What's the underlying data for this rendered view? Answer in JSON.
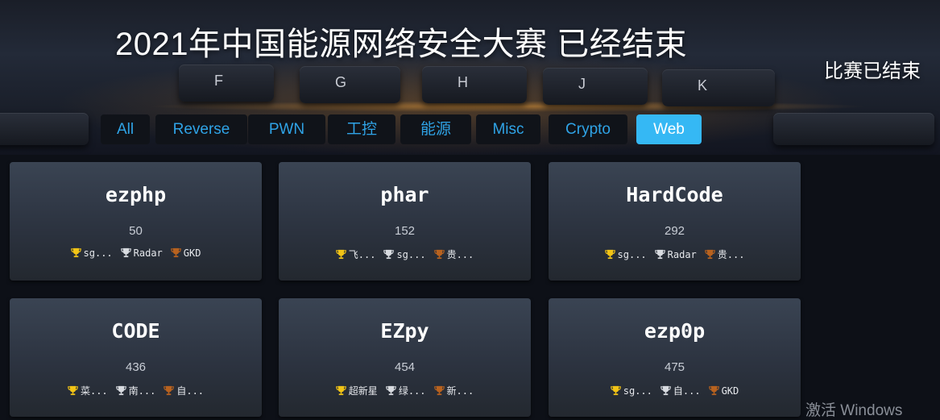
{
  "header": {
    "title": "2021年中国能源网络安全大赛 已经结束",
    "status": "比赛已结束",
    "keyboard_keys": [
      "F",
      "G",
      "H",
      "J",
      "K"
    ]
  },
  "tabs": [
    {
      "label": "All",
      "active": false
    },
    {
      "label": "Reverse",
      "active": false
    },
    {
      "label": "PWN",
      "active": false
    },
    {
      "label": "工控",
      "active": false
    },
    {
      "label": "能源",
      "active": false
    },
    {
      "label": "Misc",
      "active": false
    },
    {
      "label": "Crypto",
      "active": false
    },
    {
      "label": "Web",
      "active": true
    }
  ],
  "challenges": [
    {
      "name": "ezphp",
      "score": "50",
      "solvers": [
        "sg...",
        "Radar",
        "GKD"
      ]
    },
    {
      "name": "phar",
      "score": "152",
      "solvers": [
        "飞...",
        "sg...",
        "贵..."
      ]
    },
    {
      "name": "HardCode",
      "score": "292",
      "solvers": [
        "sg...",
        "Radar",
        "贵..."
      ]
    },
    {
      "name": "CODE",
      "score": "436",
      "solvers": [
        "菜...",
        "南...",
        "自..."
      ]
    },
    {
      "name": "EZpy",
      "score": "454",
      "solvers": [
        "超新星",
        "绿...",
        "新..."
      ]
    },
    {
      "name": "ezp0p",
      "score": "475",
      "solvers": [
        "sg...",
        "自...",
        "GKD"
      ]
    }
  ],
  "trophy_icons": [
    "gold-trophy-icon",
    "silver-trophy-icon",
    "bronze-trophy-icon"
  ],
  "colors": {
    "accent": "#35b8f4",
    "tab_text": "#2fa3e6",
    "gold": "#f2c416",
    "silver": "#d8dbe0",
    "bronze": "#b8621f"
  },
  "watermark": "激活 Windows"
}
